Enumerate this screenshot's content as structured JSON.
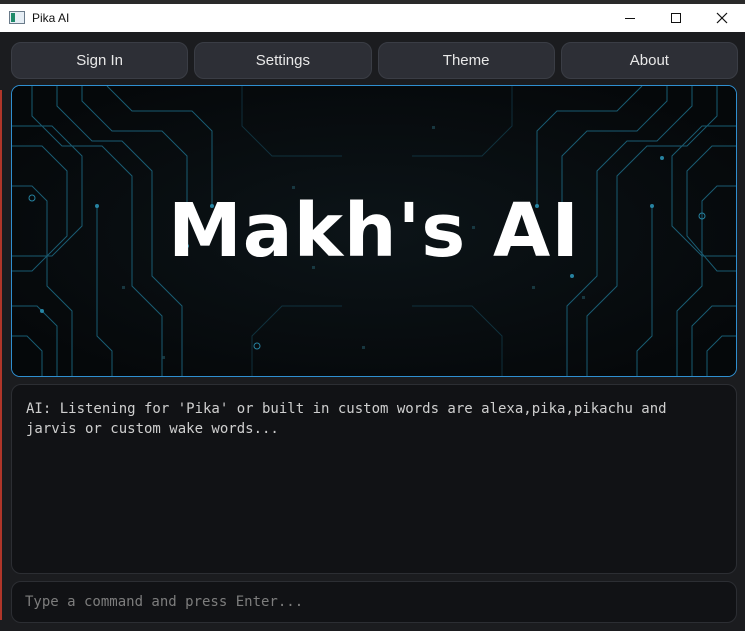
{
  "window": {
    "title": "Pika AI"
  },
  "nav": {
    "buttons": [
      {
        "label": "Sign In"
      },
      {
        "label": "Settings"
      },
      {
        "label": "Theme"
      },
      {
        "label": "About"
      }
    ]
  },
  "banner": {
    "title": "Makh's AI"
  },
  "log": {
    "text": "AI: Listening for 'Pika' or built in custom words are alexa,pika,pikachu and\njarvis or custom wake words..."
  },
  "command": {
    "placeholder": "Type a command and press Enter..."
  },
  "colors": {
    "background": "#1b1c1f",
    "button": "#2d2f36",
    "banner_border": "#2f8fd0",
    "circuit": "#1f6f8a"
  }
}
